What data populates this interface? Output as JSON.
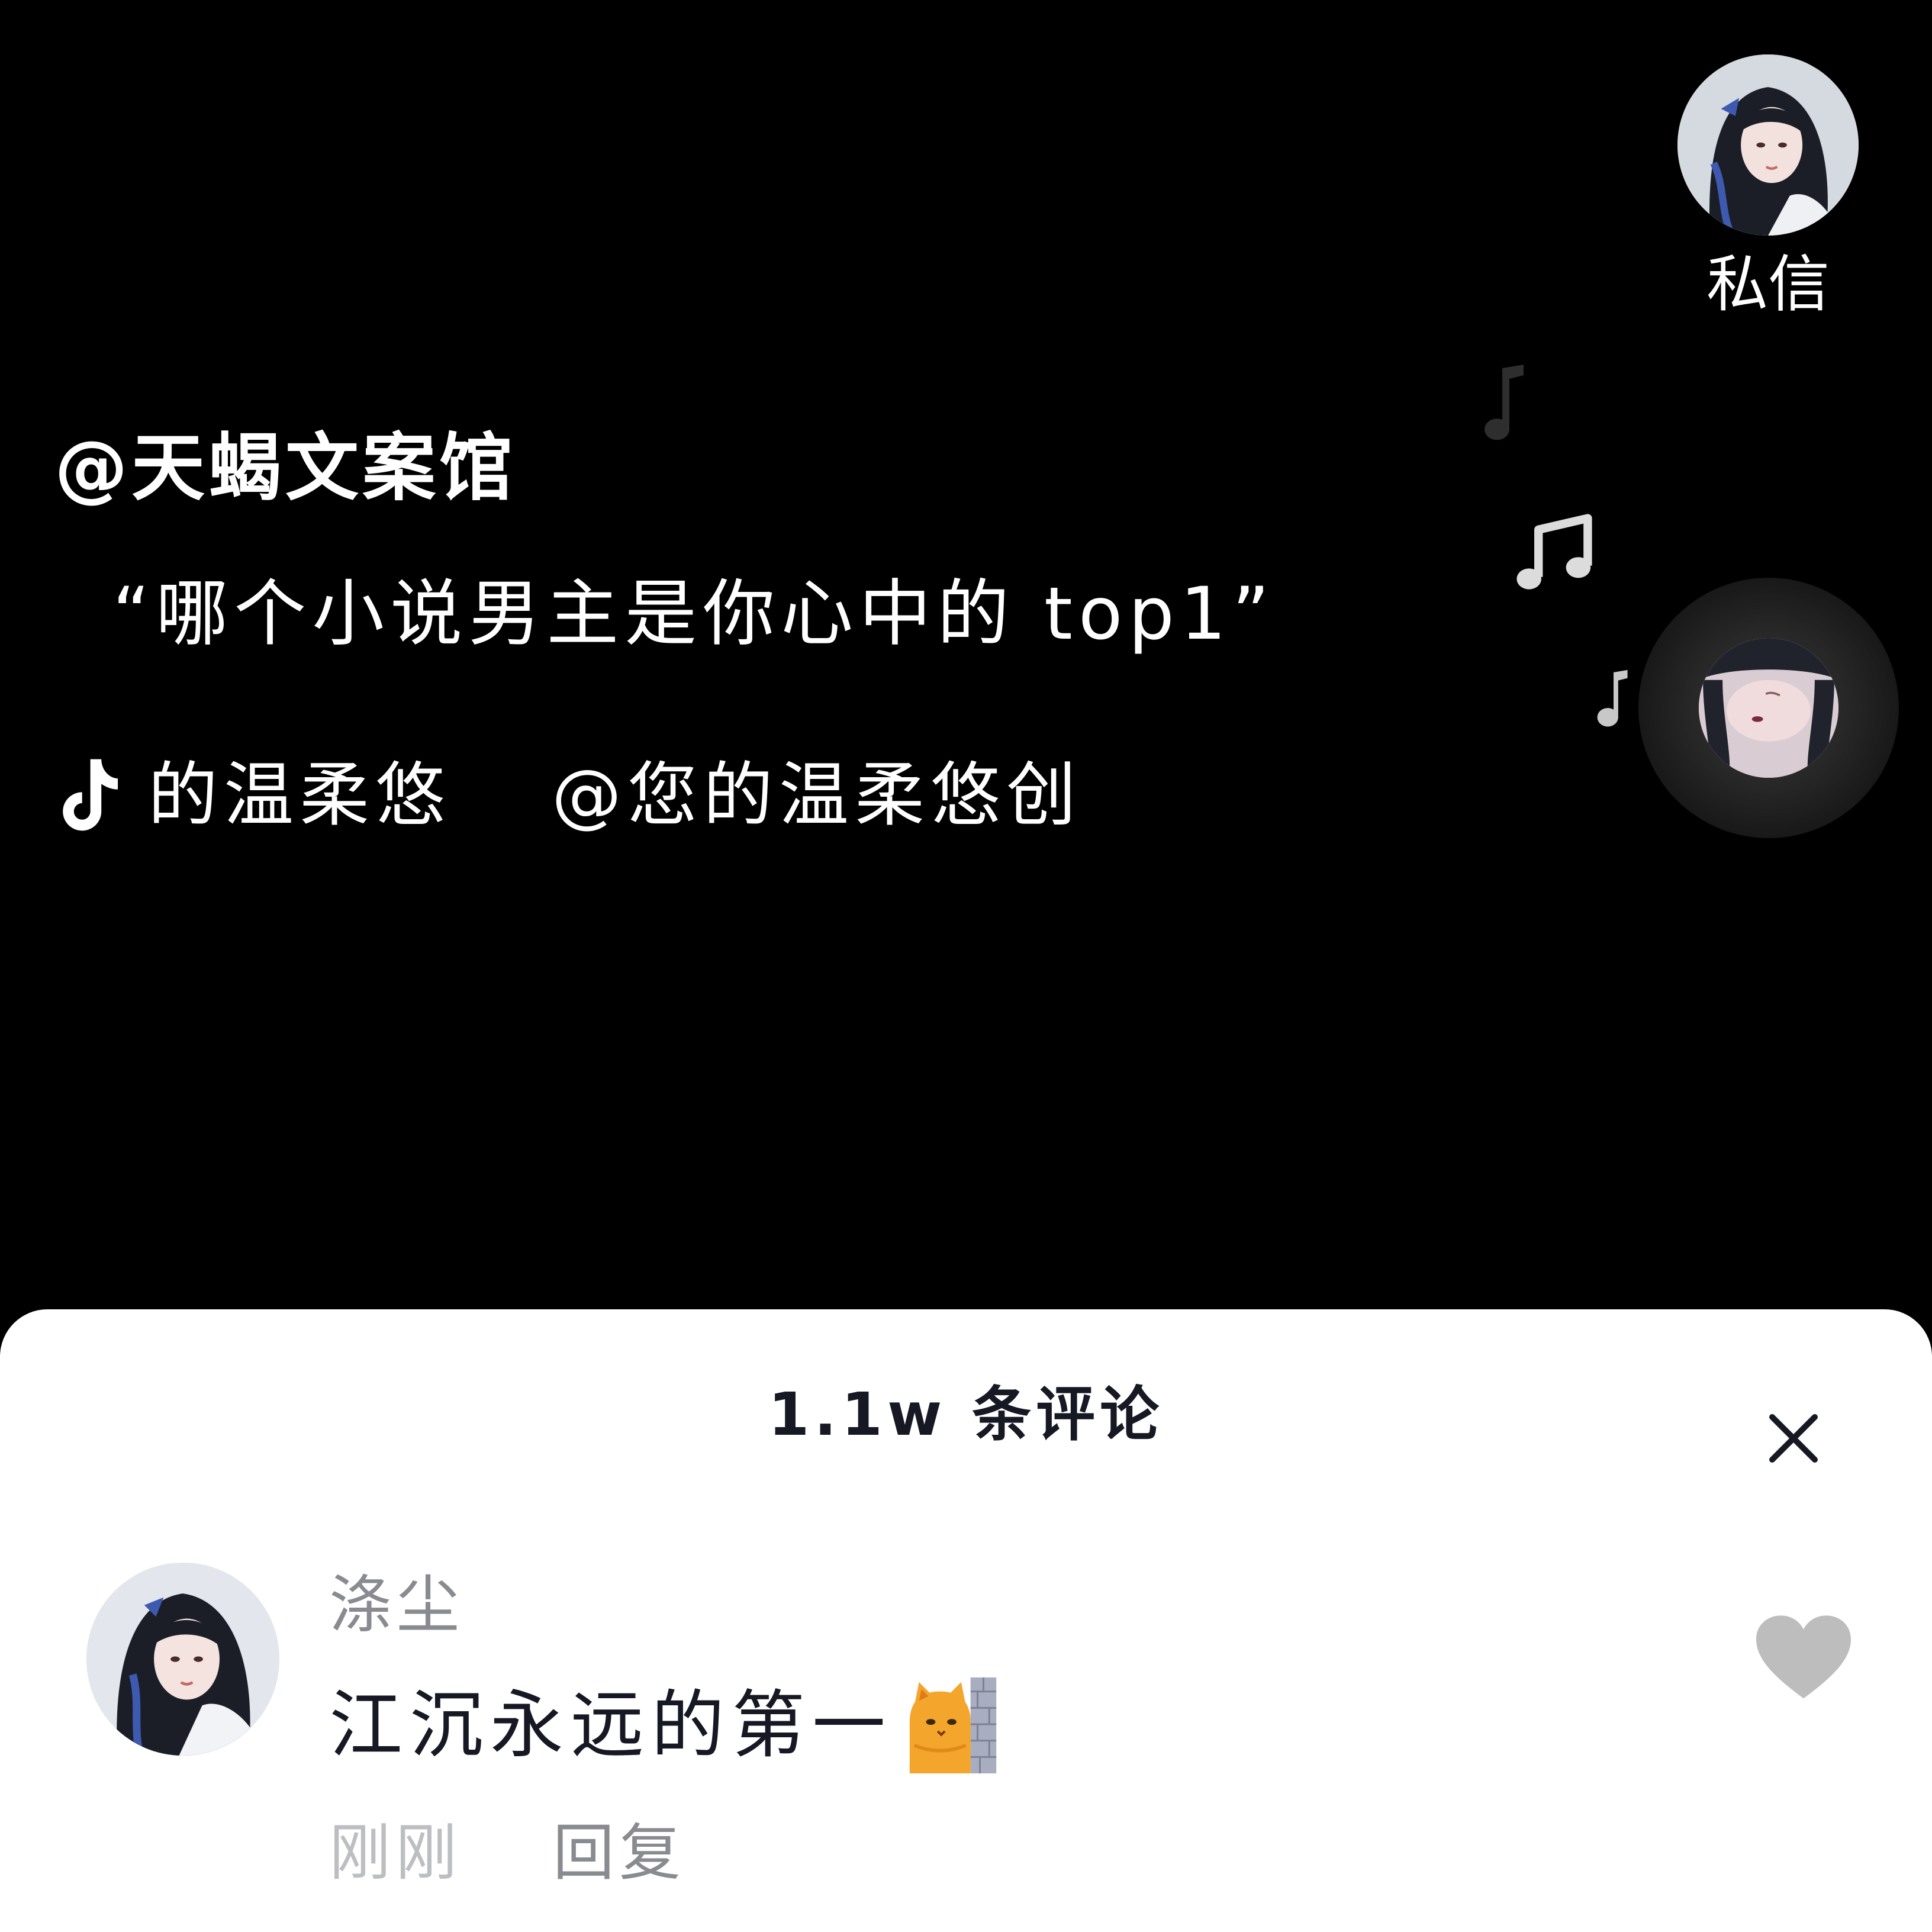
{
  "sidebar": {
    "dm_label": "私信",
    "avatar_icon": "anime-girl-avatar"
  },
  "video": {
    "author": "@天蝎文案馆",
    "caption": "“哪个小说男主是你心中的 top1”",
    "music": {
      "icon": "tiktok-note-icon",
      "name": "的温柔悠",
      "origin": "@您的温柔悠创"
    }
  },
  "comments": {
    "title": "1.1w 条评论",
    "close_icon": "close-icon",
    "items": [
      {
        "user": "涤尘",
        "text": "江沉永远的第一",
        "emoji": "cat-behind-wall-emoji",
        "time": "刚刚",
        "reply_label": "回复",
        "like_icon": "heart-icon"
      }
    ]
  },
  "colors": {
    "background": "#000000",
    "sheet": "#ffffff",
    "primary_text": "#161823",
    "secondary_text": "#8a8b91",
    "muted_text": "#bdbec2",
    "like_gray": "#bdbdbd"
  }
}
